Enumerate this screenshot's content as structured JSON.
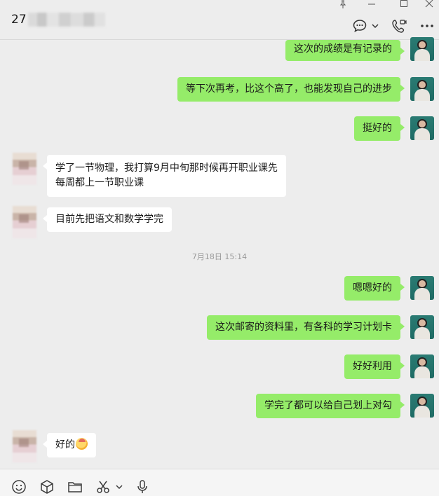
{
  "header": {
    "title": "27",
    "icons": [
      "chat-menu-icon",
      "chevron-down-icon",
      "video-call-icon",
      "more-icon"
    ],
    "window_controls": [
      "pin-icon",
      "minimize-icon",
      "maximize-icon",
      "close-icon"
    ]
  },
  "messages": [
    {
      "from": "me",
      "text": "这次的成绩是有记录的"
    },
    {
      "from": "me",
      "text": "等下次再考，比这个高了，也能发现自己的进步"
    },
    {
      "from": "me",
      "text": "挺好的"
    },
    {
      "from": "them",
      "lines": [
        "学了一节物理，我打算9月中旬那时候再开职业课先",
        "每周都上一节职业课"
      ]
    },
    {
      "from": "them",
      "text": "目前先把语文和数学学完"
    },
    {
      "from": "me",
      "text": "嗯嗯好的"
    },
    {
      "from": "me",
      "text": "这次邮寄的资料里，有各科的学习计划卡"
    },
    {
      "from": "me",
      "text": "好好利用"
    },
    {
      "from": "me",
      "text": "学完了都可以给自己划上对勾"
    },
    {
      "from": "them",
      "text": "好的",
      "emoji": "smiling-face-emoji"
    }
  ],
  "timestamp": "7月18日 15:14",
  "toolbar": {
    "icons": [
      "emoji-icon",
      "sticker-box-icon",
      "folder-icon",
      "scissors-icon",
      "chevron-down-icon",
      "microphone-icon"
    ]
  },
  "colors": {
    "background": "#ededed",
    "outgoing_bubble": "#95ec69",
    "incoming_bubble": "#ffffff"
  }
}
